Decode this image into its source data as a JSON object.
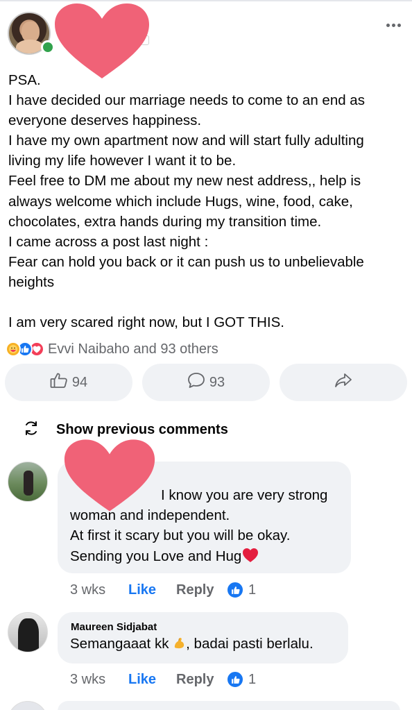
{
  "post": {
    "lines": [
      "PSA.",
      "I have decided our marriage needs to come to an end as",
      "everyone deserves happiness.",
      "I have my own apartment now and will start fully adulting",
      "living my life however I want it to be.",
      "Feel free to DM me about my new nest address,, help is",
      "always welcome which include Hugs, wine, food, cake,",
      "chocolates,  extra hands during my transition time.",
      "I came across a post last night :",
      "Fear can hold you back or it can push us to unbelievable",
      "heights"
    ],
    "closing_line": "I am very scared right now, but I GOT THIS.",
    "reactions_text": "Evvi Naibaho and 93 others",
    "reaction_icons": [
      "care-icon",
      "like-icon",
      "love-icon"
    ]
  },
  "actions": {
    "like_count": "94",
    "comment_count": "93"
  },
  "show_previous_label": "Show previous comments",
  "comments": [
    {
      "name": "",
      "lines": [
        "I know you are very strong",
        "woman and independent.",
        "At first it scary but you will be okay.",
        "Sending you Love and Hug"
      ],
      "time": "3 wks",
      "like_label": "Like",
      "reply_label": "Reply",
      "reaction_count": "1"
    },
    {
      "name": "Maureen Sidjabat",
      "text_before": "Semangaaat kk ",
      "text_after": ", badai pasti berlalu.",
      "time": "3 wks",
      "like_label": "Like",
      "reply_label": "Reply",
      "reaction_count": "1"
    }
  ],
  "colors": {
    "like_blue": "#1877f2",
    "heart_sticker": "#f06277",
    "online_green": "#31a24c",
    "bubble_gray": "#f0f2f5",
    "secondary_text": "#65676b"
  }
}
